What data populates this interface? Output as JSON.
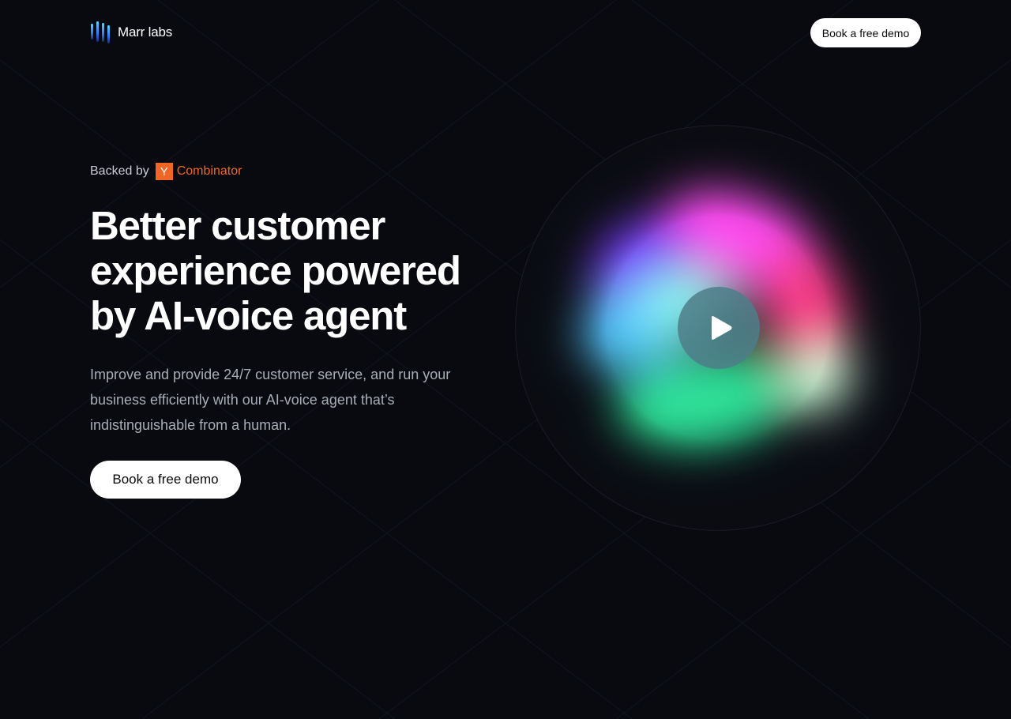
{
  "brand": {
    "name": "Marr labs",
    "logo_icon": "sound-bars-logo-icon"
  },
  "header": {
    "cta_label": "Book a free demo"
  },
  "hero": {
    "backed_by_label": "Backed by",
    "yc_badge_letter": "Y",
    "yc_name": "Combinator",
    "headline": "Better customer experience powered by AI-voice agent",
    "subtext": "Improve and provide 24/7 customer service, and run your business efficiently with our AI-voice agent that’s indistinguishable from a human.",
    "cta_label": "Book a free demo"
  },
  "media": {
    "play_icon": "play-icon"
  },
  "colors": {
    "background": "#080a10",
    "accent_yc": "#f26625",
    "button_bg": "#ffffff",
    "button_text": "#0a0a0a",
    "heading": "#ffffff",
    "body_text": "#a8adb7"
  }
}
